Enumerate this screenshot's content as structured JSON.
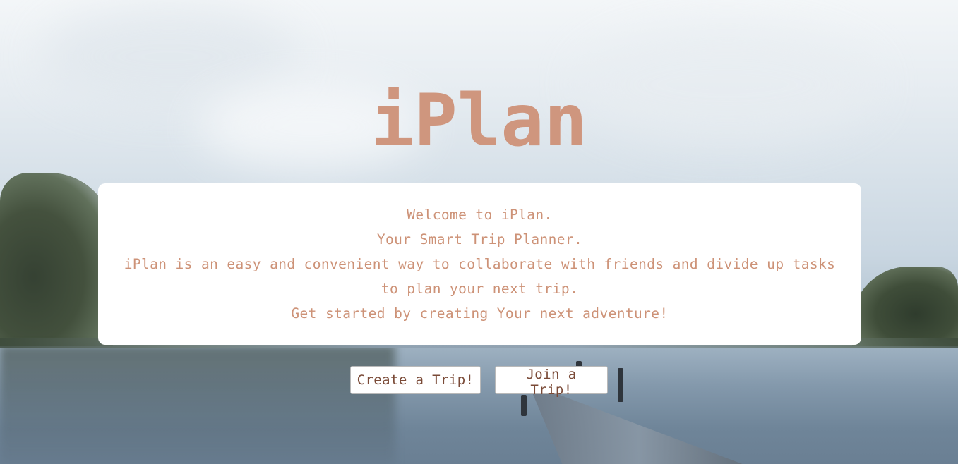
{
  "app": {
    "title": "iPlan"
  },
  "intro": {
    "lines": [
      "Welcome to iPlan.",
      "Your Smart Trip Planner.",
      "iPlan is an easy and convenient way to collaborate with friends and divide up tasks",
      "to plan your next trip.",
      "Get started by creating Your next adventure!"
    ]
  },
  "actions": {
    "create_label": "Create a Trip!",
    "join_label": "Join a Trip!"
  },
  "colors": {
    "accent": "#cf967e",
    "button_text": "#7a4a37",
    "card_background": "#ffffff"
  }
}
